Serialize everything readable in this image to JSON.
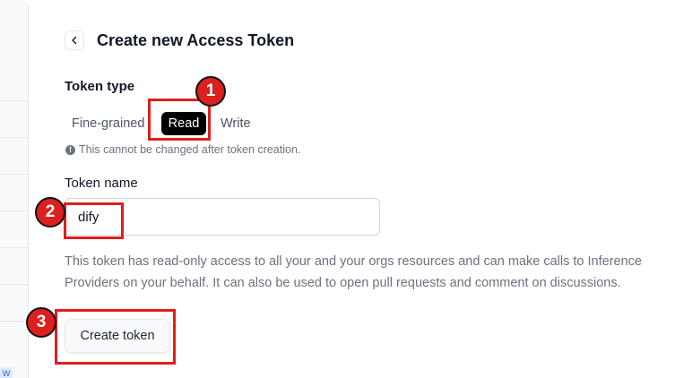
{
  "header": {
    "title": "Create new Access Token",
    "back_icon": "chevron-left-icon"
  },
  "token_type": {
    "label": "Token type",
    "options": [
      "Fine-grained",
      "Read",
      "Write"
    ],
    "selected": "Read",
    "note": "This cannot be changed after token creation.",
    "note_icon": "info-icon"
  },
  "token_name": {
    "label": "Token name",
    "value": "dify"
  },
  "description": "This token has read-only access to all your and your orgs resources and can make calls to Inference Providers on your behalf. It can also be used to open pull requests and comment on discussions.",
  "create_button": {
    "label": "Create token"
  },
  "sidebar": {
    "badge": "W"
  },
  "annotations": {
    "markers": [
      "1",
      "2",
      "3"
    ],
    "color": "#e11d1d"
  },
  "colors": {
    "selected_bg": "#000000",
    "text_muted": "#6b7280"
  }
}
